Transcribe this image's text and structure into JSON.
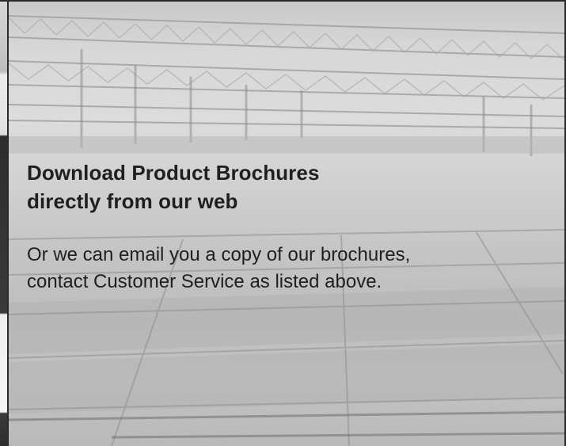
{
  "headline": {
    "line1": "Download Product Brochures",
    "line2": "directly from our web"
  },
  "body": {
    "line1": "Or we can email you a copy of our brochures,",
    "line2": "contact Customer Service as listed above."
  },
  "colors": {
    "text": "#1f1f1f",
    "photo_tone": "#cfcfcf",
    "frame": "#2a2a2a"
  }
}
